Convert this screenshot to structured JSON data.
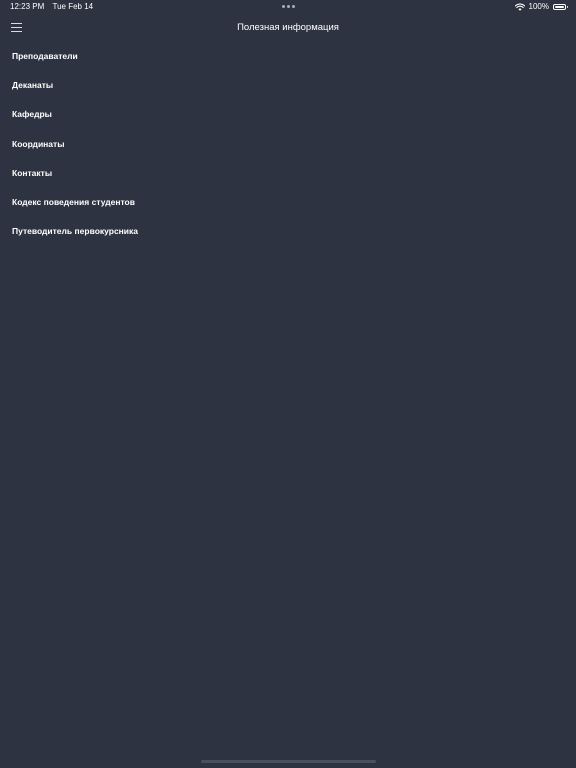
{
  "status_bar": {
    "time": "12:23 PM",
    "date": "Tue Feb 14",
    "battery_percent": "100%",
    "icons": [
      "multitasking-dots-icon",
      "wifi-icon",
      "battery-icon"
    ]
  },
  "nav_bar": {
    "title": "Полезная информация",
    "menu_icon": "hamburger-menu-icon"
  },
  "menu": {
    "items": [
      {
        "label": "Преподаватели"
      },
      {
        "label": "Деканаты"
      },
      {
        "label": "Кафедры"
      },
      {
        "label": "Координаты"
      },
      {
        "label": "Контакты"
      },
      {
        "label": "Кодекс поведения студентов"
      },
      {
        "label": "Путеводитель первокурсника"
      }
    ]
  },
  "colors": {
    "background": "#2d3340",
    "text": "#ffffff",
    "home_indicator": "#4a5060"
  }
}
